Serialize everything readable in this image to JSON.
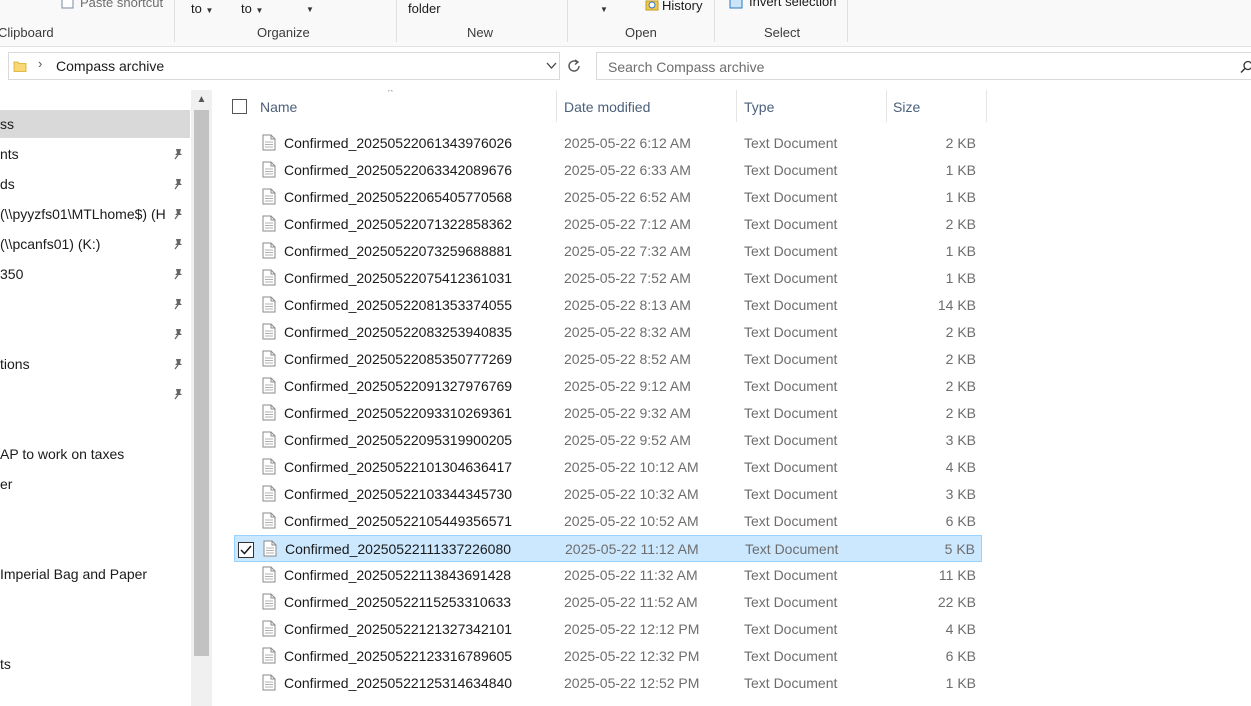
{
  "ribbon": {
    "clipboard_label": "Clipboard",
    "paste_shortcut": "Paste shortcut",
    "move_to": "to",
    "copy_to": "to",
    "organize_label": "Organize",
    "new_folder": "folder",
    "new_label": "New",
    "open_label": "Open",
    "history": "History",
    "select_label": "Select",
    "invert_selection": "Invert selection"
  },
  "address": {
    "path": "Compass archive"
  },
  "search": {
    "placeholder": "Search Compass archive"
  },
  "nav": {
    "items": [
      {
        "label": "ss",
        "pinned": false,
        "selected": true
      },
      {
        "label": "nts",
        "pinned": true
      },
      {
        "label": "ds",
        "pinned": true
      },
      {
        "label": "(\\\\pyyzfs01\\MTLhome$) (H",
        "pinned": true
      },
      {
        "label": " (\\\\pcanfs01) (K:)",
        "pinned": true
      },
      {
        "label": "350",
        "pinned": true
      },
      {
        "label": "",
        "pinned": true
      },
      {
        "label": "",
        "pinned": true
      },
      {
        "label": "tions",
        "pinned": true
      },
      {
        "label": "",
        "pinned": true
      },
      {
        "label": "",
        "pinned": false
      },
      {
        "label": "AP to work on taxes",
        "pinned": false
      },
      {
        "label": "er",
        "pinned": false
      },
      {
        "label": "",
        "pinned": false
      },
      {
        "label": "",
        "pinned": false
      },
      {
        "label": "Imperial Bag and Paper",
        "pinned": false
      },
      {
        "label": "",
        "pinned": false
      },
      {
        "label": "",
        "pinned": false
      },
      {
        "label": "ts",
        "pinned": false
      }
    ]
  },
  "columns": {
    "name": "Name",
    "date": "Date modified",
    "type": "Type",
    "size": "Size"
  },
  "files": [
    {
      "name": "Confirmed_20250522061343976026",
      "date": "2025-05-22 6:12 AM",
      "type": "Text Document",
      "size": "2 KB"
    },
    {
      "name": "Confirmed_20250522063342089676",
      "date": "2025-05-22 6:33 AM",
      "type": "Text Document",
      "size": "1 KB"
    },
    {
      "name": "Confirmed_20250522065405770568",
      "date": "2025-05-22 6:52 AM",
      "type": "Text Document",
      "size": "1 KB"
    },
    {
      "name": "Confirmed_20250522071322858362",
      "date": "2025-05-22 7:12 AM",
      "type": "Text Document",
      "size": "2 KB"
    },
    {
      "name": "Confirmed_20250522073259688881",
      "date": "2025-05-22 7:32 AM",
      "type": "Text Document",
      "size": "1 KB"
    },
    {
      "name": "Confirmed_20250522075412361031",
      "date": "2025-05-22 7:52 AM",
      "type": "Text Document",
      "size": "1 KB"
    },
    {
      "name": "Confirmed_20250522081353374055",
      "date": "2025-05-22 8:13 AM",
      "type": "Text Document",
      "size": "14 KB"
    },
    {
      "name": "Confirmed_20250522083253940835",
      "date": "2025-05-22 8:32 AM",
      "type": "Text Document",
      "size": "2 KB"
    },
    {
      "name": "Confirmed_20250522085350777269",
      "date": "2025-05-22 8:52 AM",
      "type": "Text Document",
      "size": "2 KB"
    },
    {
      "name": "Confirmed_20250522091327976769",
      "date": "2025-05-22 9:12 AM",
      "type": "Text Document",
      "size": "2 KB"
    },
    {
      "name": "Confirmed_20250522093310269361",
      "date": "2025-05-22 9:32 AM",
      "type": "Text Document",
      "size": "2 KB"
    },
    {
      "name": "Confirmed_20250522095319900205",
      "date": "2025-05-22 9:52 AM",
      "type": "Text Document",
      "size": "3 KB"
    },
    {
      "name": "Confirmed_20250522101304636417",
      "date": "2025-05-22 10:12 AM",
      "type": "Text Document",
      "size": "4 KB"
    },
    {
      "name": "Confirmed_20250522103344345730",
      "date": "2025-05-22 10:32 AM",
      "type": "Text Document",
      "size": "3 KB"
    },
    {
      "name": "Confirmed_20250522105449356571",
      "date": "2025-05-22 10:52 AM",
      "type": "Text Document",
      "size": "6 KB"
    },
    {
      "name": "Confirmed_20250522111337226080",
      "date": "2025-05-22 11:12 AM",
      "type": "Text Document",
      "size": "5 KB",
      "selected": true
    },
    {
      "name": "Confirmed_20250522113843691428",
      "date": "2025-05-22 11:32 AM",
      "type": "Text Document",
      "size": "11 KB"
    },
    {
      "name": "Confirmed_20250522115253310633",
      "date": "2025-05-22 11:52 AM",
      "type": "Text Document",
      "size": "22 KB"
    },
    {
      "name": "Confirmed_20250522121327342101",
      "date": "2025-05-22 12:12 PM",
      "type": "Text Document",
      "size": "4 KB"
    },
    {
      "name": "Confirmed_20250522123316789605",
      "date": "2025-05-22 12:32 PM",
      "type": "Text Document",
      "size": "6 KB"
    },
    {
      "name": "Confirmed_20250522125314634840",
      "date": "2025-05-22 12:52 PM",
      "type": "Text Document",
      "size": "1 KB"
    }
  ],
  "colors": {
    "selection_bg": "#cce8ff",
    "selection_border": "#99d1ff",
    "header_text": "#4c607a",
    "nav_selected": "#d9d9d9"
  }
}
